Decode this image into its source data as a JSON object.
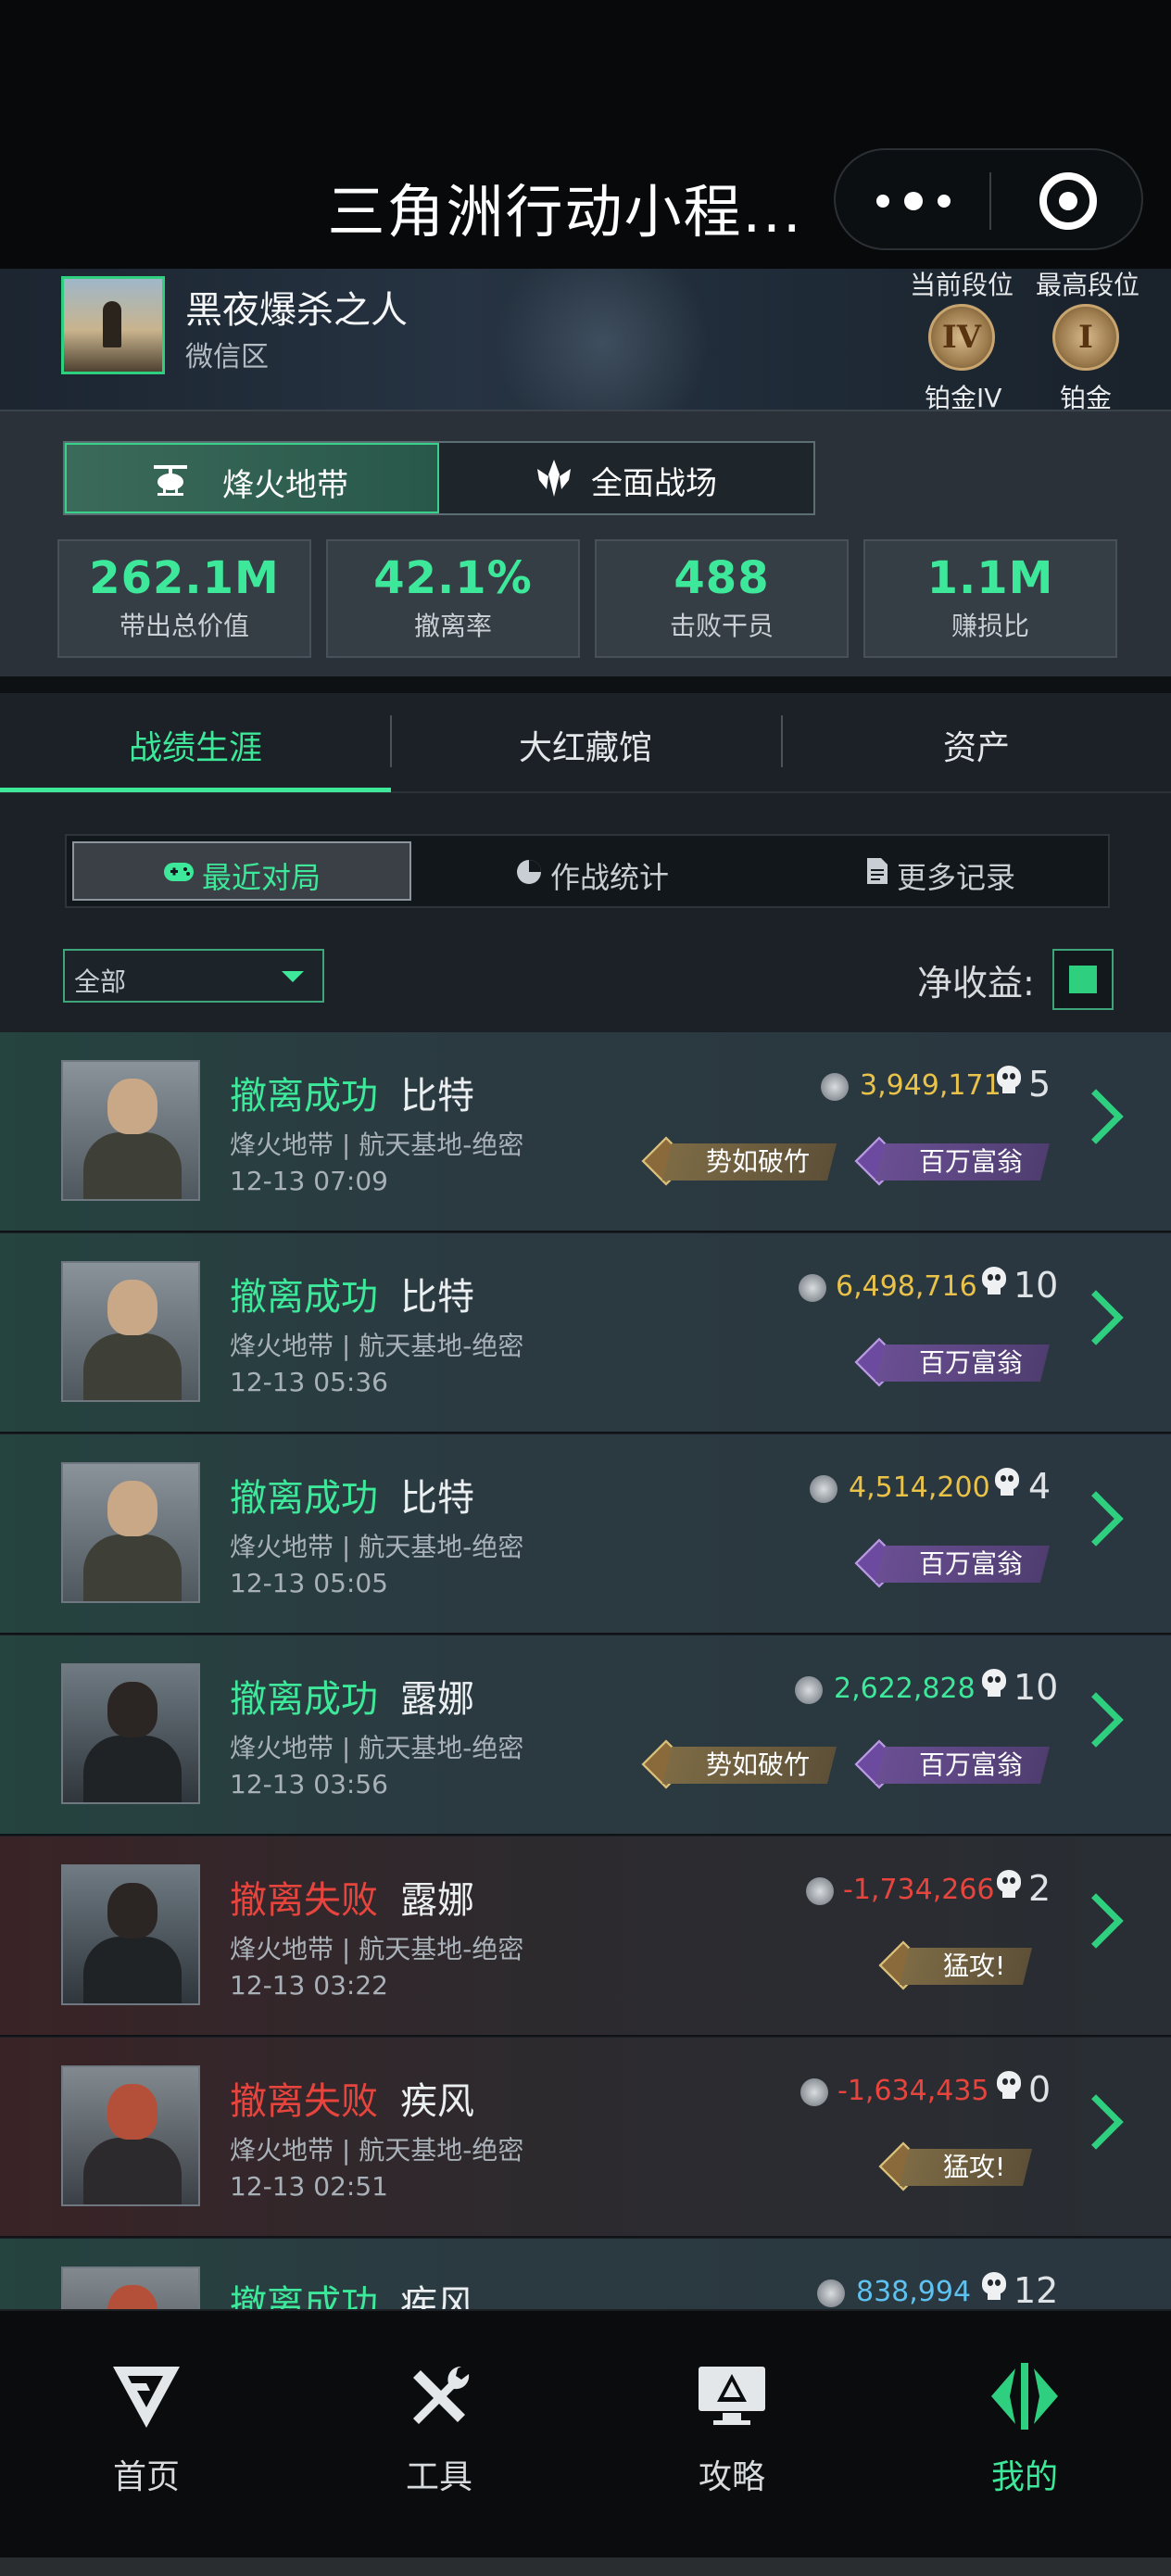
{
  "title_bar": {
    "title": "三角洲行动小程...",
    "more_icon": "more-dots-icon",
    "close_icon": "target-icon"
  },
  "profile": {
    "name": "黑夜爆杀之人",
    "region": "微信区",
    "current_rank_label": "当前段位",
    "current_rank_numeral": "IV",
    "current_rank_name": "铂金IV",
    "highest_rank_label": "最高段位",
    "highest_rank_numeral": "I",
    "highest_rank_name": "铂金"
  },
  "modes": {
    "active": "烽火地带",
    "other": "全面战场"
  },
  "stats": [
    {
      "value": "262.1M",
      "label": "带出总价值"
    },
    {
      "value": "42.1%",
      "label": "撤离率"
    },
    {
      "value": "488",
      "label": "击败干员"
    },
    {
      "value": "1.1M",
      "label": "赚损比"
    }
  ],
  "tabs": [
    "战绩生涯",
    "大红藏馆",
    "资产"
  ],
  "subtabs": [
    "最近对局",
    "作战统计",
    "更多记录"
  ],
  "filter": {
    "value": "全部",
    "net_label": "净收益:"
  },
  "matches": [
    {
      "status": "撤离成功",
      "operator": "比特",
      "map": "烽火地带 | 航天基地-绝密",
      "time": "12-13 07:09",
      "value": "3,949,171",
      "kills": "5",
      "badges": [
        "势如破竹",
        "百万富翁"
      ]
    },
    {
      "status": "撤离成功",
      "operator": "比特",
      "map": "烽火地带 | 航天基地-绝密",
      "time": "12-13 05:36",
      "value": "6,498,716",
      "kills": "10",
      "badges": [
        "百万富翁"
      ]
    },
    {
      "status": "撤离成功",
      "operator": "比特",
      "map": "烽火地带 | 航天基地-绝密",
      "time": "12-13 05:05",
      "value": "4,514,200",
      "kills": "4",
      "badges": [
        "百万富翁"
      ]
    },
    {
      "status": "撤离成功",
      "operator": "露娜",
      "map": "烽火地带 | 航天基地-绝密",
      "time": "12-13 03:56",
      "value": "2,622,828",
      "kills": "10",
      "badges": [
        "势如破竹",
        "百万富翁"
      ]
    },
    {
      "status": "撤离失败",
      "operator": "露娜",
      "map": "烽火地带 | 航天基地-绝密",
      "time": "12-13 03:22",
      "value": "-1,734,266",
      "kills": "2",
      "badges": [
        "猛攻!"
      ]
    },
    {
      "status": "撤离失败",
      "operator": "疾风",
      "map": "烽火地带 | 航天基地-绝密",
      "time": "12-13 02:51",
      "value": "-1,634,435",
      "kills": "0",
      "badges": [
        "猛攻!"
      ]
    },
    {
      "status": "撤离成功",
      "operator": "疾风",
      "value": "838,994",
      "kills": "12"
    }
  ],
  "nav": [
    "首页",
    "工具",
    "攻略",
    "我的"
  ],
  "colors": {
    "accent": "#3ee89a",
    "fail": "#e8443e",
    "gold": "#e9c24a",
    "blue": "#5ec2f0"
  }
}
